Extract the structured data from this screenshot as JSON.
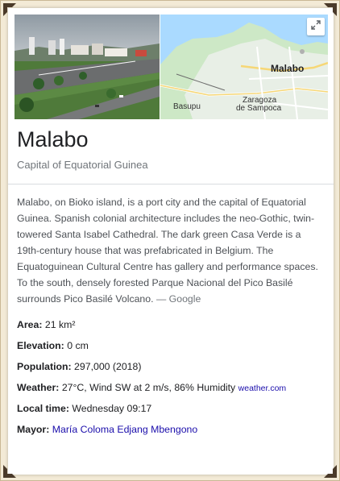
{
  "place": {
    "name": "Malabo",
    "subtitle": "Capital of Equatorial Guinea",
    "description": "Malabo, on Bioko island, is a port city and the capital of Equatorial Guinea. Spanish colonial architecture includes the neo-Gothic, twin-towered Santa Isabel Cathedral. The dark green Casa Verde is a 19th-century house that was prefabricated in Belgium. The Equatoguinean Cultural Centre has gallery and performance spaces. To the south, densely forested Parque Nacional del Pico Basilé surrounds Pico Basilé Volcano.",
    "description_source": "— Google"
  },
  "map": {
    "labels": {
      "city": "Malabo",
      "district1": "Zaragoza",
      "district2": "de Sampoca",
      "town": "Basupu"
    }
  },
  "facts": [
    {
      "label": "Area:",
      "value": "21 km²"
    },
    {
      "label": "Elevation:",
      "value": "0 cm"
    },
    {
      "label": "Population:",
      "value": "297,000 (2018)"
    },
    {
      "label": "Weather:",
      "value": "27°C, Wind SW at 2 m/s, 86% Humidity",
      "source": "weather.com"
    },
    {
      "label": "Local time:",
      "value": "Wednesday 09:17"
    },
    {
      "label": "Mayor:",
      "value": "María Coloma Edjang Mbengono"
    }
  ],
  "colors": {
    "link": "#1a0dab",
    "title": "#202124",
    "muted": "#70757a"
  }
}
